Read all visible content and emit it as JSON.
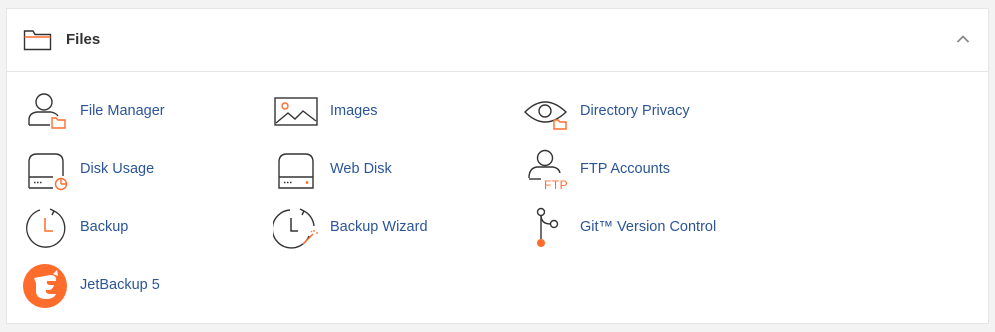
{
  "section": {
    "title": "Files",
    "icon": "folder-icon",
    "collapse_icon": "chevron-up-icon"
  },
  "items": [
    {
      "label": "File Manager",
      "icon": "file-manager-icon"
    },
    {
      "label": "Images",
      "icon": "images-icon"
    },
    {
      "label": "Directory Privacy",
      "icon": "directory-privacy-icon"
    },
    {
      "label": "Disk Usage",
      "icon": "disk-usage-icon"
    },
    {
      "label": "Web Disk",
      "icon": "web-disk-icon"
    },
    {
      "label": "FTP Accounts",
      "icon": "ftp-accounts-icon"
    },
    {
      "label": "Backup",
      "icon": "backup-icon"
    },
    {
      "label": "Backup Wizard",
      "icon": "backup-wizard-icon"
    },
    {
      "label": "Git™ Version Control",
      "icon": "git-version-control-icon"
    },
    {
      "label": "JetBackup 5",
      "icon": "jetbackup-icon"
    }
  ],
  "colors": {
    "link": "#2b5597",
    "accent": "#ff6c2c",
    "icon_stroke": "#333333"
  }
}
